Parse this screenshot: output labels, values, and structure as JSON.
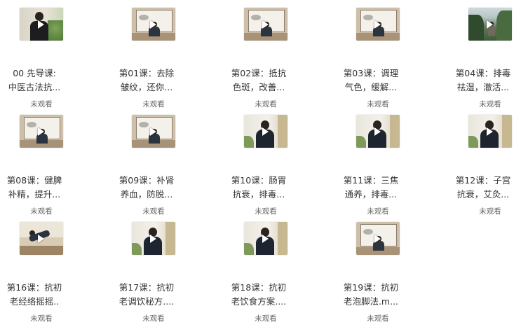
{
  "status_label": "未观看",
  "lessons": [
    {
      "line1": "00 先导课:",
      "line2": "中医古法抗...",
      "thumb": "portrait-green"
    },
    {
      "line1": "第01课：去除",
      "line2": "皱纹，还你...",
      "thumb": "room-board"
    },
    {
      "line1": "第02课：抵抗",
      "line2": "色斑，改善...",
      "thumb": "room-board"
    },
    {
      "line1": "第03课：调理",
      "line2": "气色，缓解...",
      "thumb": "room-board"
    },
    {
      "line1": "第04课：排毒",
      "line2": "祛湿，澈活...",
      "thumb": "mountain"
    },
    {
      "line1": "第08课：健脾",
      "line2": "补精，提升...",
      "thumb": "room-board"
    },
    {
      "line1": "第09课：补肾",
      "line2": "养血，防脱...",
      "thumb": "room-board"
    },
    {
      "line1": "第10课：肠胃",
      "line2": "抗衰，排毒...",
      "thumb": "closeup"
    },
    {
      "line1": "第11课：三焦",
      "line2": "通养，排毒...",
      "thumb": "closeup"
    },
    {
      "line1": "第12课：子宫",
      "line2": "抗衰，艾灸...",
      "thumb": "closeup"
    },
    {
      "line1": "第16课：抗初",
      "line2": "老经络摇摇..",
      "thumb": "exercise"
    },
    {
      "line1": "第17课：抗初",
      "line2": "老调饮秘方....",
      "thumb": "closeup"
    },
    {
      "line1": "第18课：抗初",
      "line2": "老饮食方案....",
      "thumb": "closeup"
    },
    {
      "line1": "第19课：抗初",
      "line2": "老泡脚法.m...",
      "thumb": "room-board"
    }
  ]
}
